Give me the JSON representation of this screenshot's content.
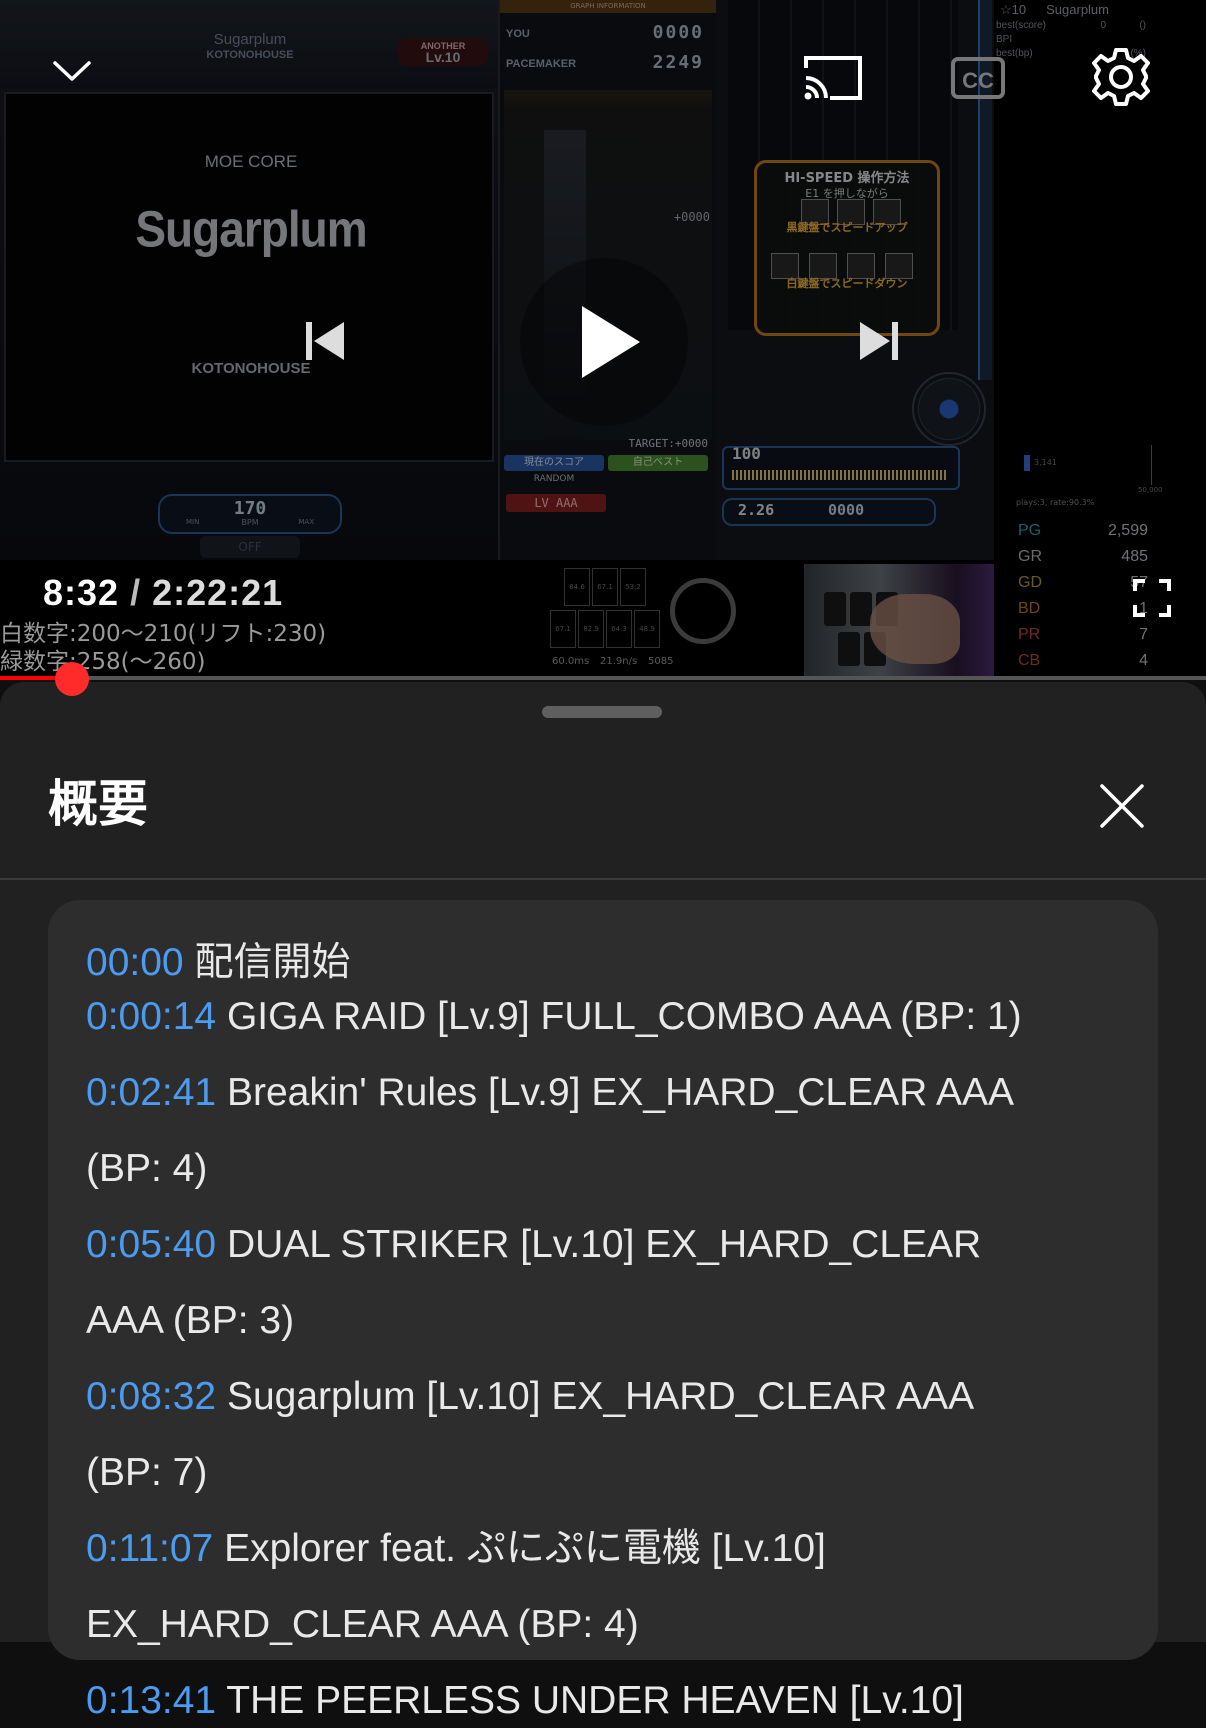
{
  "player": {
    "current_time": "8:32",
    "separator": "/",
    "duration": "2:22:21",
    "progress": 0.06,
    "caption_line1": "白数字:200〜210(リフト:230)",
    "caption_line2": "緑数字:258(〜260)"
  },
  "game": {
    "song_title": "Sugarplum",
    "artist": "KOTONOHOUSE",
    "genre": "MOE CORE",
    "difficulty": "ANOTHER",
    "level": "Lv.10",
    "bpm": "170",
    "bpm_label": "BPM",
    "bpm_min": "MIN",
    "bpm_max": "MAX",
    "option": "OFF",
    "graph_header": "GRAPH INFORMATION",
    "you_label": "YOU",
    "you_value": "0000",
    "pacemaker_label": "PACEMAKER",
    "pacemaker_value": "2249",
    "plus_value": "+0000",
    "target": "TARGET:+0000",
    "current_score_btn": "現在のスコア",
    "best_btn": "自己ベスト",
    "random": "RANDOM",
    "lv_rank": "LV AAA",
    "hs_title": "HI-SPEED 操作方法",
    "hs_hold": "E1 を押しながら",
    "hs_up": "黒鍵盤でスピードアップ",
    "hs_down": "白鍵盤でスピードダウン",
    "gauge_value": "100",
    "hispeed": "2.26",
    "score": "0000"
  },
  "stats": {
    "star_level": "☆10",
    "song": "Sugarplum",
    "best_score_label": "best(score)",
    "best_score_value": "0",
    "best_score_extra": "()",
    "bpi_label": "BPI",
    "best_bp_label": "best(bp)",
    "best_bp_extra": "(%)",
    "hist_value": "3,141",
    "hist_max": "50,000",
    "plays": "plays:3,   rate:90.3%",
    "judges": [
      {
        "k": "PG",
        "v": "2,599",
        "color": "#3aa0b8"
      },
      {
        "k": "GR",
        "v": "485",
        "color": "#b8b8b8"
      },
      {
        "k": "GD",
        "v": "57",
        "color": "#b99a3a"
      },
      {
        "k": "BD",
        "v": "1",
        "color": "#c07a2a"
      },
      {
        "k": "PR",
        "v": "7",
        "color": "#c04a4a"
      },
      {
        "k": "CB",
        "v": "4",
        "color": "#c04a4a"
      }
    ]
  },
  "stepper": {
    "cells": [
      "84.6",
      "67.1",
      "53.2",
      "67.1",
      "82.9",
      "64.3",
      "48.9"
    ],
    "ms": "60.0ms",
    "nps": "21.9n/s",
    "notes": "5085"
  },
  "controls": {
    "collapse": "chevron-down-icon",
    "prev": "skip-previous-icon",
    "play": "play-icon",
    "next": "skip-next-icon",
    "cast": "cast-icon",
    "captions": "closed-captions-icon",
    "settings": "gear-icon",
    "fullscreen": "fullscreen-icon",
    "close": "close-icon"
  },
  "sheet": {
    "title": "概要"
  },
  "chapters": [
    {
      "time": "00:00",
      "text": "配信開始"
    },
    {
      "time": "0:00:14",
      "text": "GIGA RAID [Lv.9] FULL_COMBO AAA (BP: 1)"
    },
    {
      "time": "0:02:41",
      "text": "Breakin' Rules [Lv.9] EX_HARD_CLEAR AAA",
      "cont": "(BP: 4)"
    },
    {
      "time": "0:05:40",
      "text": "DUAL STRIKER [Lv.10] EX_HARD_CLEAR",
      "cont": "AAA (BP: 3)"
    },
    {
      "time": "0:08:32",
      "text": "Sugarplum [Lv.10] EX_HARD_CLEAR AAA",
      "cont": "(BP: 7)"
    },
    {
      "time": "0:11:07",
      "text": "Explorer feat. ぷにぷに電機 [Lv.10]",
      "cont": "EX_HARD_CLEAR AAA (BP: 4)"
    },
    {
      "time": "0:13:41",
      "text": "THE PEERLESS UNDER HEAVEN [Lv.10]"
    }
  ],
  "colors": {
    "accent": "#ff0000",
    "timestamp": "#4b9cf0",
    "sheet_bg": "#212121",
    "card_bg": "#2d2d2d"
  }
}
